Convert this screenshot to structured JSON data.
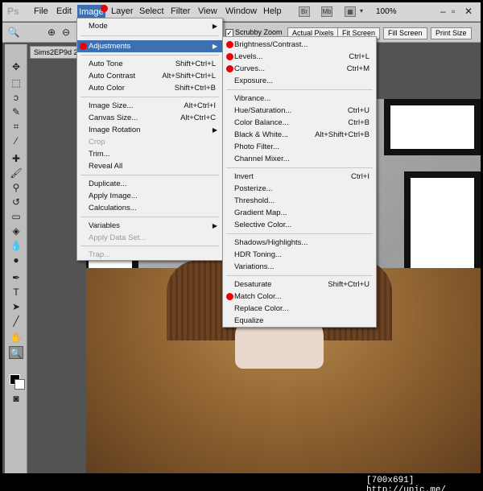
{
  "menubar": {
    "logo": "Ps",
    "items": [
      "File",
      "Edit",
      "Image",
      "Layer",
      "Select",
      "Filter",
      "View",
      "Window",
      "Help"
    ],
    "icons": [
      "Br",
      "Mb"
    ],
    "zoom": "100%"
  },
  "optionsbar": {
    "scrubby_zoom": "Scrubby Zoom",
    "actual_pixels": "Actual Pixels",
    "fit_screen": "Fit Screen",
    "fill_screen": "Fill Screen",
    "print_size": "Print Size"
  },
  "document": {
    "tab": "Sims2EP9d 2"
  },
  "image_menu": {
    "mode": "Mode",
    "adjustments": "Adjustments",
    "auto_tone": {
      "label": "Auto Tone",
      "shortcut": "Shift+Ctrl+L"
    },
    "auto_contrast": {
      "label": "Auto Contrast",
      "shortcut": "Alt+Shift+Ctrl+L"
    },
    "auto_color": {
      "label": "Auto Color",
      "shortcut": "Shift+Ctrl+B"
    },
    "image_size": {
      "label": "Image Size...",
      "shortcut": "Alt+Ctrl+I"
    },
    "canvas_size": {
      "label": "Canvas Size...",
      "shortcut": "Alt+Ctrl+C"
    },
    "image_rotation": "Image Rotation",
    "crop": "Crop",
    "trim": "Trim...",
    "reveal_all": "Reveal All",
    "duplicate": "Duplicate...",
    "apply_image": "Apply Image...",
    "calculations": "Calculations...",
    "variables": "Variables",
    "apply_data_set": "Apply Data Set...",
    "trap": "Trap..."
  },
  "adjustments_menu": {
    "brightness_contrast": {
      "label": "Brightness/Contrast...",
      "shortcut": ""
    },
    "levels": {
      "label": "Levels...",
      "shortcut": "Ctrl+L"
    },
    "curves": {
      "label": "Curves...",
      "shortcut": "Ctrl+M"
    },
    "exposure": {
      "label": "Exposure...",
      "shortcut": ""
    },
    "vibrance": {
      "label": "Vibrance...",
      "shortcut": ""
    },
    "hue_saturation": {
      "label": "Hue/Saturation...",
      "shortcut": "Ctrl+U"
    },
    "color_balance": {
      "label": "Color Balance...",
      "shortcut": "Ctrl+B"
    },
    "black_white": {
      "label": "Black & White...",
      "shortcut": "Alt+Shift+Ctrl+B"
    },
    "photo_filter": {
      "label": "Photo Filter...",
      "shortcut": ""
    },
    "channel_mixer": {
      "label": "Channel Mixer...",
      "shortcut": ""
    },
    "invert": {
      "label": "Invert",
      "shortcut": "Ctrl+I"
    },
    "posterize": {
      "label": "Posterize...",
      "shortcut": ""
    },
    "threshold": {
      "label": "Threshold...",
      "shortcut": ""
    },
    "gradient_map": {
      "label": "Gradient Map...",
      "shortcut": ""
    },
    "selective_color": {
      "label": "Selective Color...",
      "shortcut": ""
    },
    "shadows_highlights": {
      "label": "Shadows/Highlights...",
      "shortcut": ""
    },
    "hdr_toning": {
      "label": "HDR Toning...",
      "shortcut": ""
    },
    "variations": {
      "label": "Variations...",
      "shortcut": ""
    },
    "desaturate": {
      "label": "Desaturate",
      "shortcut": "Shift+Ctrl+U"
    },
    "match_color": {
      "label": "Match Color...",
      "shortcut": ""
    },
    "replace_color": {
      "label": "Replace Color...",
      "shortcut": ""
    },
    "equalize": {
      "label": "Equalize",
      "shortcut": ""
    }
  },
  "footer": "[700x691] http://upic.me/",
  "colors": {
    "highlight": "#3d6fb3",
    "marker": "#e00000"
  }
}
